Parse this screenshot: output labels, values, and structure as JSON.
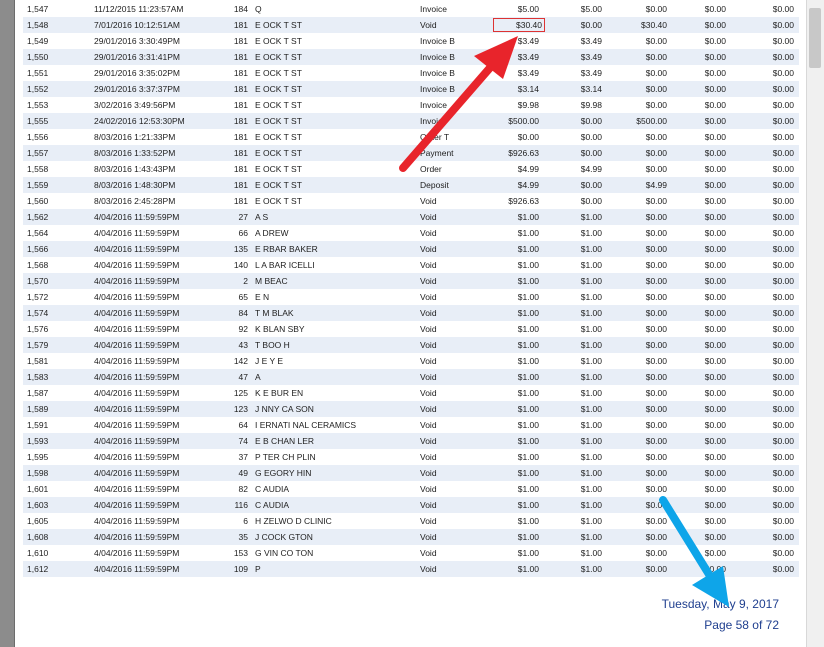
{
  "report": {
    "rows": [
      {
        "id": "1,547",
        "date": "11/12/2015 11:23:57AM",
        "cust": "184",
        "name": "Q",
        "type": "Invoice",
        "amount": "$5.00",
        "c1": "$5.00",
        "c2": "$0.00",
        "c3": "$0.00",
        "c4": "$0.00"
      },
      {
        "id": "1,548",
        "date": "7/01/2016 10:12:51AM",
        "cust": "181",
        "name": "E OCK T ST",
        "type": "Void",
        "amount": "$30.40",
        "c1": "$0.00",
        "c2": "$30.40",
        "c3": "$0.00",
        "c4": "$0.00",
        "boxed": true
      },
      {
        "id": "1,549",
        "date": "29/01/2016 3:30:49PM",
        "cust": "181",
        "name": "E OCK T ST",
        "type": "Invoice B",
        "amount": "$3.49",
        "c1": "$3.49",
        "c2": "$0.00",
        "c3": "$0.00",
        "c4": "$0.00"
      },
      {
        "id": "1,550",
        "date": "29/01/2016 3:31:41PM",
        "cust": "181",
        "name": "E OCK T ST",
        "type": "Invoice B",
        "amount": "$3.49",
        "c1": "$3.49",
        "c2": "$0.00",
        "c3": "$0.00",
        "c4": "$0.00"
      },
      {
        "id": "1,551",
        "date": "29/01/2016 3:35:02PM",
        "cust": "181",
        "name": "E OCK T ST",
        "type": "Invoice B",
        "amount": "$3.49",
        "c1": "$3.49",
        "c2": "$0.00",
        "c3": "$0.00",
        "c4": "$0.00"
      },
      {
        "id": "1,552",
        "date": "29/01/2016 3:37:37PM",
        "cust": "181",
        "name": "E OCK T ST",
        "type": "Invoice B",
        "amount": "$3.14",
        "c1": "$3.14",
        "c2": "$0.00",
        "c3": "$0.00",
        "c4": "$0.00"
      },
      {
        "id": "1,553",
        "date": "3/02/2016 3:49:56PM",
        "cust": "181",
        "name": "E OCK T ST",
        "type": "Invoice",
        "amount": "$9.98",
        "c1": "$9.98",
        "c2": "$0.00",
        "c3": "$0.00",
        "c4": "$0.00"
      },
      {
        "id": "1,555",
        "date": "24/02/2016 12:53:30PM",
        "cust": "181",
        "name": "E OCK T ST",
        "type": "Invoice",
        "amount": "$500.00",
        "c1": "$0.00",
        "c2": "$500.00",
        "c3": "$0.00",
        "c4": "$0.00"
      },
      {
        "id": "1,556",
        "date": "8/03/2016 1:21:33PM",
        "cust": "181",
        "name": "E OCK T ST",
        "type": "Order T",
        "amount": "$0.00",
        "c1": "$0.00",
        "c2": "$0.00",
        "c3": "$0.00",
        "c4": "$0.00"
      },
      {
        "id": "1,557",
        "date": "8/03/2016 1:33:52PM",
        "cust": "181",
        "name": "E OCK T ST",
        "type": "Payment",
        "amount": "$926.63",
        "c1": "$0.00",
        "c2": "$0.00",
        "c3": "$0.00",
        "c4": "$0.00"
      },
      {
        "id": "1,558",
        "date": "8/03/2016 1:43:43PM",
        "cust": "181",
        "name": "E OCK T ST",
        "type": "Order",
        "amount": "$4.99",
        "c1": "$4.99",
        "c2": "$0.00",
        "c3": "$0.00",
        "c4": "$0.00"
      },
      {
        "id": "1,559",
        "date": "8/03/2016 1:48:30PM",
        "cust": "181",
        "name": "E OCK T ST",
        "type": "Deposit",
        "amount": "$4.99",
        "c1": "$0.00",
        "c2": "$4.99",
        "c3": "$0.00",
        "c4": "$0.00"
      },
      {
        "id": "1,560",
        "date": "8/03/2016 2:45:28PM",
        "cust": "181",
        "name": "E OCK T ST",
        "type": "Void",
        "amount": "$926.63",
        "c1": "$0.00",
        "c2": "$0.00",
        "c3": "$0.00",
        "c4": "$0.00"
      },
      {
        "id": "1,562",
        "date": "4/04/2016 11:59:59PM",
        "cust": "27",
        "name": "A S",
        "type": "Void",
        "amount": "$1.00",
        "c1": "$1.00",
        "c2": "$0.00",
        "c3": "$0.00",
        "c4": "$0.00"
      },
      {
        "id": "1,564",
        "date": "4/04/2016 11:59:59PM",
        "cust": "66",
        "name": "A DREW",
        "type": "Void",
        "amount": "$1.00",
        "c1": "$1.00",
        "c2": "$0.00",
        "c3": "$0.00",
        "c4": "$0.00"
      },
      {
        "id": "1,566",
        "date": "4/04/2016 11:59:59PM",
        "cust": "135",
        "name": "E RBAR BAKER",
        "type": "Void",
        "amount": "$1.00",
        "c1": "$1.00",
        "c2": "$0.00",
        "c3": "$0.00",
        "c4": "$0.00"
      },
      {
        "id": "1,568",
        "date": "4/04/2016 11:59:59PM",
        "cust": "140",
        "name": "L A BAR ICELLI",
        "type": "Void",
        "amount": "$1.00",
        "c1": "$1.00",
        "c2": "$0.00",
        "c3": "$0.00",
        "c4": "$0.00"
      },
      {
        "id": "1,570",
        "date": "4/04/2016 11:59:59PM",
        "cust": "2",
        "name": "M BEAC",
        "type": "Void",
        "amount": "$1.00",
        "c1": "$1.00",
        "c2": "$0.00",
        "c3": "$0.00",
        "c4": "$0.00"
      },
      {
        "id": "1,572",
        "date": "4/04/2016 11:59:59PM",
        "cust": "65",
        "name": "E N",
        "type": "Void",
        "amount": "$1.00",
        "c1": "$1.00",
        "c2": "$0.00",
        "c3": "$0.00",
        "c4": "$0.00"
      },
      {
        "id": "1,574",
        "date": "4/04/2016 11:59:59PM",
        "cust": "84",
        "name": "T M BLAK",
        "type": "Void",
        "amount": "$1.00",
        "c1": "$1.00",
        "c2": "$0.00",
        "c3": "$0.00",
        "c4": "$0.00"
      },
      {
        "id": "1,576",
        "date": "4/04/2016 11:59:59PM",
        "cust": "92",
        "name": "K BLAN SBY",
        "type": "Void",
        "amount": "$1.00",
        "c1": "$1.00",
        "c2": "$0.00",
        "c3": "$0.00",
        "c4": "$0.00"
      },
      {
        "id": "1,579",
        "date": "4/04/2016 11:59:59PM",
        "cust": "43",
        "name": "T BOO H",
        "type": "Void",
        "amount": "$1.00",
        "c1": "$1.00",
        "c2": "$0.00",
        "c3": "$0.00",
        "c4": "$0.00"
      },
      {
        "id": "1,581",
        "date": "4/04/2016 11:59:59PM",
        "cust": "142",
        "name": "J E Y E",
        "type": "Void",
        "amount": "$1.00",
        "c1": "$1.00",
        "c2": "$0.00",
        "c3": "$0.00",
        "c4": "$0.00"
      },
      {
        "id": "1,583",
        "date": "4/04/2016 11:59:59PM",
        "cust": "47",
        "name": "A",
        "type": "Void",
        "amount": "$1.00",
        "c1": "$1.00",
        "c2": "$0.00",
        "c3": "$0.00",
        "c4": "$0.00"
      },
      {
        "id": "1,587",
        "date": "4/04/2016 11:59:59PM",
        "cust": "125",
        "name": "K E BUR EN",
        "type": "Void",
        "amount": "$1.00",
        "c1": "$1.00",
        "c2": "$0.00",
        "c3": "$0.00",
        "c4": "$0.00"
      },
      {
        "id": "1,589",
        "date": "4/04/2016 11:59:59PM",
        "cust": "123",
        "name": "J NNY CA SON",
        "type": "Void",
        "amount": "$1.00",
        "c1": "$1.00",
        "c2": "$0.00",
        "c3": "$0.00",
        "c4": "$0.00"
      },
      {
        "id": "1,591",
        "date": "4/04/2016 11:59:59PM",
        "cust": "64",
        "name": "I ERNATI NAL CERAMICS",
        "type": "Void",
        "amount": "$1.00",
        "c1": "$1.00",
        "c2": "$0.00",
        "c3": "$0.00",
        "c4": "$0.00"
      },
      {
        "id": "1,593",
        "date": "4/04/2016 11:59:59PM",
        "cust": "74",
        "name": "E B CHAN LER",
        "type": "Void",
        "amount": "$1.00",
        "c1": "$1.00",
        "c2": "$0.00",
        "c3": "$0.00",
        "c4": "$0.00"
      },
      {
        "id": "1,595",
        "date": "4/04/2016 11:59:59PM",
        "cust": "37",
        "name": "P TER CH PLIN",
        "type": "Void",
        "amount": "$1.00",
        "c1": "$1.00",
        "c2": "$0.00",
        "c3": "$0.00",
        "c4": "$0.00"
      },
      {
        "id": "1,598",
        "date": "4/04/2016 11:59:59PM",
        "cust": "49",
        "name": "G EGORY HIN",
        "type": "Void",
        "amount": "$1.00",
        "c1": "$1.00",
        "c2": "$0.00",
        "c3": "$0.00",
        "c4": "$0.00"
      },
      {
        "id": "1,601",
        "date": "4/04/2016 11:59:59PM",
        "cust": "82",
        "name": "C AUDIA",
        "type": "Void",
        "amount": "$1.00",
        "c1": "$1.00",
        "c2": "$0.00",
        "c3": "$0.00",
        "c4": "$0.00"
      },
      {
        "id": "1,603",
        "date": "4/04/2016 11:59:59PM",
        "cust": "116",
        "name": "C AUDIA",
        "type": "Void",
        "amount": "$1.00",
        "c1": "$1.00",
        "c2": "$0.00",
        "c3": "$0.00",
        "c4": "$0.00"
      },
      {
        "id": "1,605",
        "date": "4/04/2016 11:59:59PM",
        "cust": "6",
        "name": "H ZELWO D CLINIC",
        "type": "Void",
        "amount": "$1.00",
        "c1": "$1.00",
        "c2": "$0.00",
        "c3": "$0.00",
        "c4": "$0.00"
      },
      {
        "id": "1,608",
        "date": "4/04/2016 11:59:59PM",
        "cust": "35",
        "name": "J COCK GTON",
        "type": "Void",
        "amount": "$1.00",
        "c1": "$1.00",
        "c2": "$0.00",
        "c3": "$0.00",
        "c4": "$0.00"
      },
      {
        "id": "1,610",
        "date": "4/04/2016 11:59:59PM",
        "cust": "153",
        "name": "G VIN CO TON",
        "type": "Void",
        "amount": "$1.00",
        "c1": "$1.00",
        "c2": "$0.00",
        "c3": "$0.00",
        "c4": "$0.00"
      },
      {
        "id": "1,612",
        "date": "4/04/2016 11:59:59PM",
        "cust": "109",
        "name": "P",
        "type": "Void",
        "amount": "$1.00",
        "c1": "$1.00",
        "c2": "$0.00",
        "c3": "$0.00",
        "c4": "$0.00"
      }
    ]
  },
  "footer": {
    "date": "Tuesday, May 9, 2017",
    "page": "Page 58 of 72"
  },
  "colors": {
    "row_alt_bg": "#e8eef7",
    "footer_text": "#1f3f8f",
    "red_arrow": "#e8242b",
    "blue_arrow": "#0ea5e9",
    "highlight_box": "#d33333"
  },
  "icons": {
    "red_arrow": "arrow-annotation-icon",
    "blue_arrow": "arrow-annotation-icon"
  }
}
